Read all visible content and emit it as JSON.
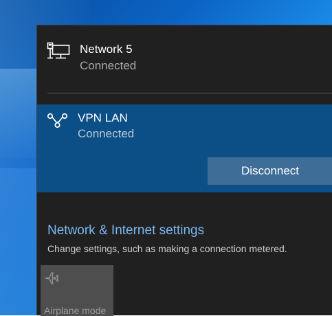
{
  "network": {
    "name": "Network 5",
    "status": "Connected",
    "icon": "wired-network-icon"
  },
  "vpn": {
    "name": "VPN LAN",
    "status": "Connected",
    "icon": "vpn-icon",
    "disconnect_label": "Disconnect"
  },
  "settings": {
    "link_label": "Network & Internet settings",
    "description": "Change settings, such as making a connection metered."
  },
  "quick_actions": [
    {
      "label": "Airplane mode",
      "icon": "airplane-icon",
      "state": "off"
    }
  ],
  "colors": {
    "panel_bg": "#202020",
    "selected_bg": "#0c4f86",
    "button_bg": "#3e6d97",
    "link": "#7ab8f0",
    "tile_bg": "#4e4e4e"
  }
}
